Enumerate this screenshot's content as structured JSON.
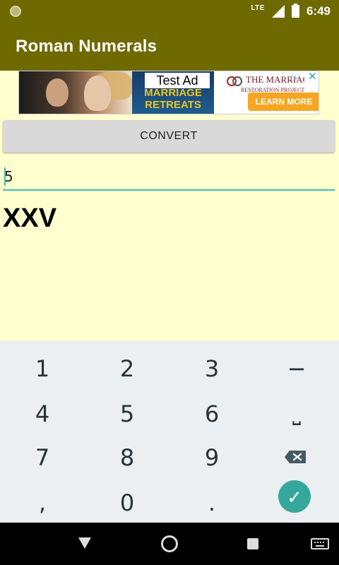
{
  "status_bar": {
    "network": "LTE",
    "time": "6:49"
  },
  "app_bar": {
    "title": "Roman Numerals"
  },
  "ad": {
    "label": "Test Ad",
    "headline": "MARRIAGE RETREATS",
    "brand": "THE MARRIAGE",
    "brand_sub": "RESTORATION PROJECT",
    "cta": "LEARN MORE",
    "info_icon": "info-triangle-icon",
    "close_icon": "close-icon"
  },
  "convert": {
    "label": "CONVERT"
  },
  "input": {
    "value": "5"
  },
  "result": {
    "text": "XXV"
  },
  "keyboard": {
    "keys": [
      "1",
      "2",
      "3",
      "−",
      "4",
      "5",
      "6",
      "⎵",
      "7",
      "8",
      "9",
      ",",
      "0",
      "."
    ]
  },
  "colors": {
    "app_bar": "#6e6a00",
    "page_background": "#ffffd0",
    "accent": "#35c3b5"
  }
}
